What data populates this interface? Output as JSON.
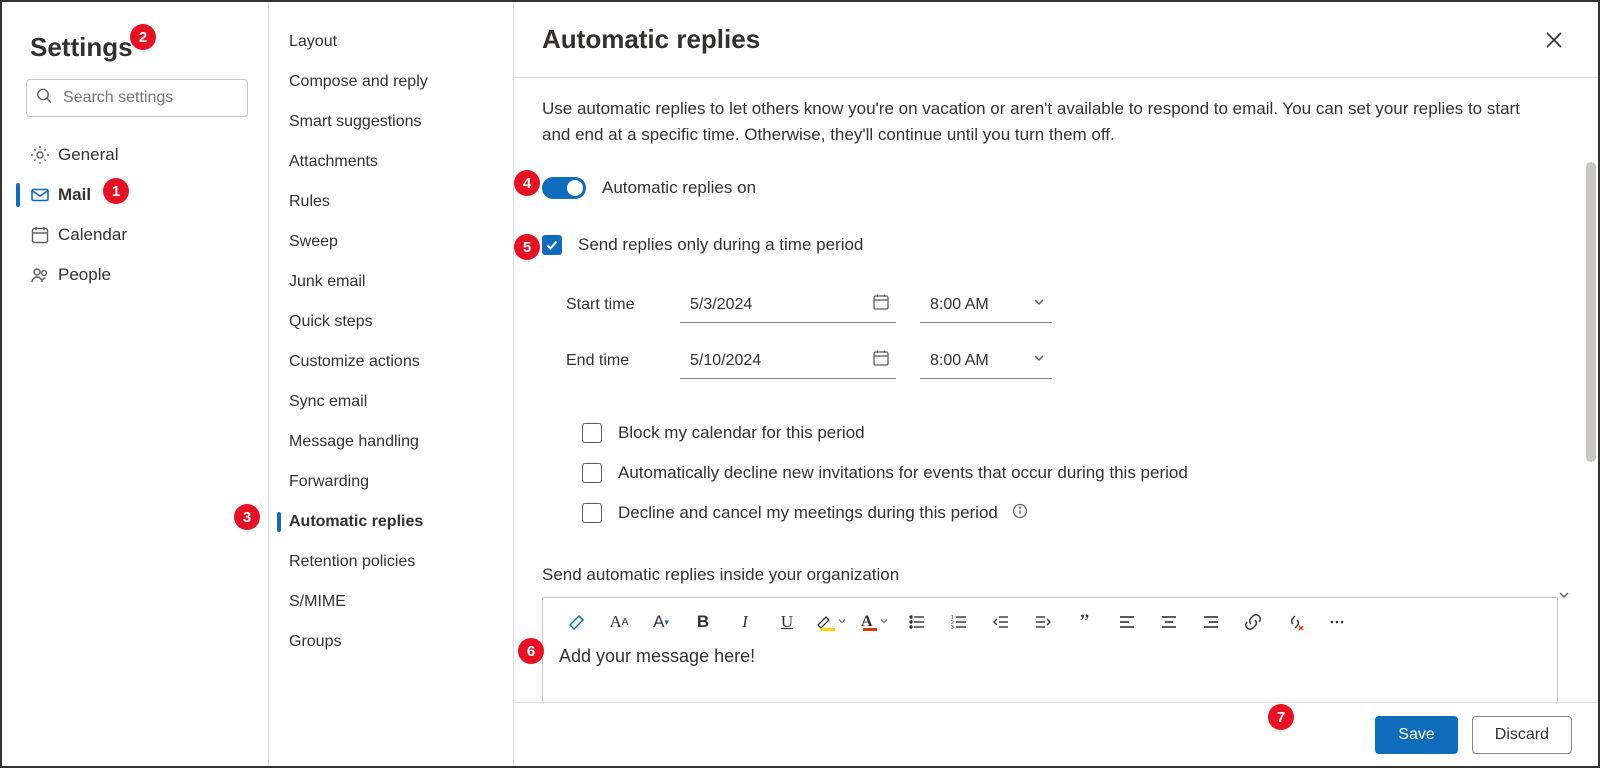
{
  "settings_title": "Settings",
  "search_placeholder": "Search settings",
  "categories": [
    {
      "label": "General"
    },
    {
      "label": "Mail"
    },
    {
      "label": "Calendar"
    },
    {
      "label": "People"
    }
  ],
  "mail_subnav": [
    {
      "label": "Layout"
    },
    {
      "label": "Compose and reply"
    },
    {
      "label": "Smart suggestions"
    },
    {
      "label": "Attachments"
    },
    {
      "label": "Rules"
    },
    {
      "label": "Sweep"
    },
    {
      "label": "Junk email"
    },
    {
      "label": "Quick steps"
    },
    {
      "label": "Customize actions"
    },
    {
      "label": "Sync email"
    },
    {
      "label": "Message handling"
    },
    {
      "label": "Forwarding"
    },
    {
      "label": "Automatic replies"
    },
    {
      "label": "Retention policies"
    },
    {
      "label": "S/MIME"
    },
    {
      "label": "Groups"
    }
  ],
  "panel": {
    "title": "Automatic replies",
    "description": "Use automatic replies to let others know you're on vacation or aren't available to respond to email. You can set your replies to start and end at a specific time. Otherwise, they'll continue until you turn them off.",
    "toggle_label": "Automatic replies on",
    "period_checkbox": "Send replies only during a time period",
    "start_label": "Start time",
    "end_label": "End time",
    "start_date": "5/3/2024",
    "start_time": "8:00 AM",
    "end_date": "5/10/2024",
    "end_time": "8:00 AM",
    "opt_block": "Block my calendar for this period",
    "opt_decline_new": "Automatically decline new invitations for events that occur during this period",
    "opt_cancel": "Decline and cancel my meetings during this period",
    "section_label": "Send automatic replies inside your organization",
    "editor_placeholder": "Add your message here!"
  },
  "buttons": {
    "save": "Save",
    "discard": "Discard"
  },
  "callouts": [
    "1",
    "2",
    "3",
    "4",
    "5",
    "6",
    "7"
  ]
}
